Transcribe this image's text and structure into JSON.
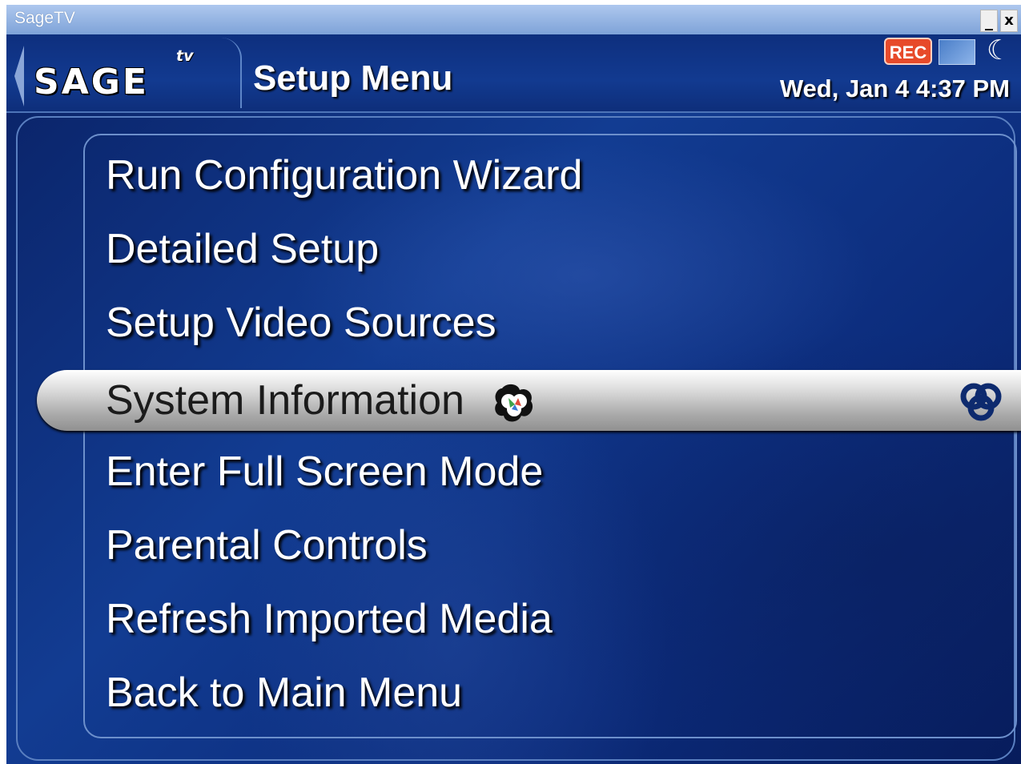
{
  "window": {
    "title": "SageTV",
    "minimize_label": "_",
    "close_label": "x"
  },
  "header": {
    "logo_text": "SAGE",
    "logo_sup": "tv",
    "page_title": "Setup Menu",
    "rec_badge": "REC",
    "datetime": "Wed, Jan 4 4:37 PM",
    "icons": [
      "back-arrow-icon",
      "screen-icon",
      "moon-icon"
    ]
  },
  "menu": {
    "items": [
      {
        "label": "Run Configuration Wizard"
      },
      {
        "label": "Detailed Setup"
      },
      {
        "label": "Setup Video Sources"
      },
      {
        "label": "System Information",
        "selected": true
      },
      {
        "label": "Enter Full Screen Mode"
      },
      {
        "label": "Parental Controls"
      },
      {
        "label": "Refresh Imported Media"
      },
      {
        "label": "Back to Main Menu"
      }
    ],
    "highlight_icons": [
      "sage-cursor-icon",
      "sage-focus-icon"
    ]
  },
  "colors": {
    "background": "#0b2a78",
    "titlebar": "#9cbbe8",
    "rec": "#e74a2a",
    "highlight": "#d0d0d0"
  }
}
